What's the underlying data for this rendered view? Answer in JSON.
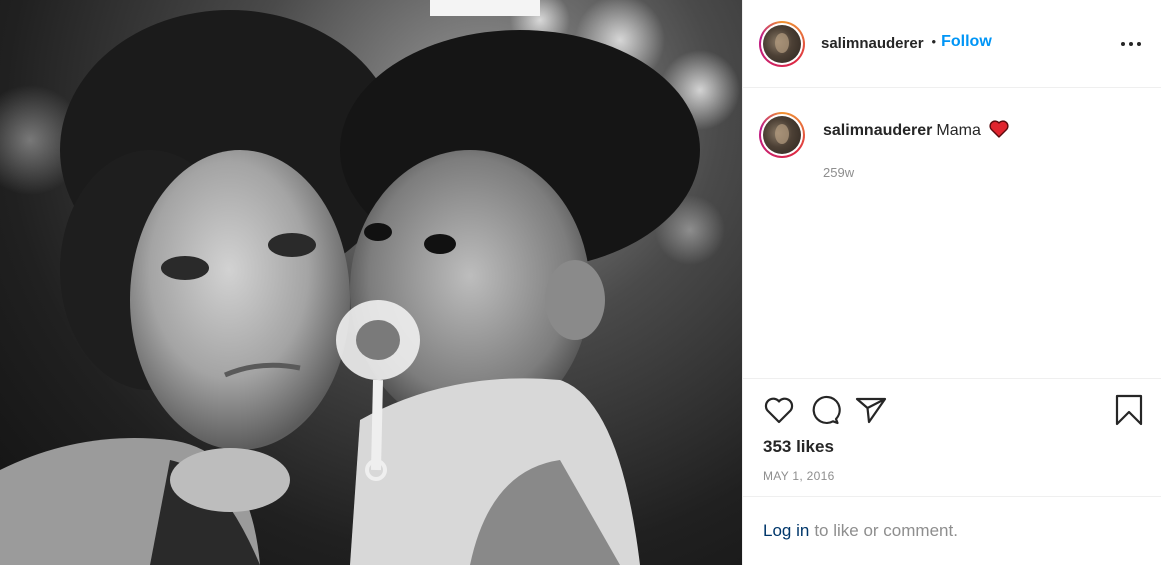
{
  "post": {
    "author": "salimnauderer",
    "follow_separator": "•",
    "follow_label": "Follow",
    "caption_text": "Mama",
    "caption_emoji": "red-heart",
    "time_ago": "259w",
    "likes": "353 likes",
    "date": "MAY 1, 2016",
    "login_link": "Log in",
    "login_suffix": "to like or comment."
  },
  "icons": {
    "like": "heart-outline-icon",
    "comment": "comment-bubble-icon",
    "share": "paper-plane-icon",
    "save": "bookmark-icon",
    "more": "more-options-icon"
  },
  "colors": {
    "follow": "#0095f6",
    "login_link": "#00376b",
    "muted": "#8e8e8e",
    "text": "#262626",
    "heart_emoji": "#e0242e"
  }
}
